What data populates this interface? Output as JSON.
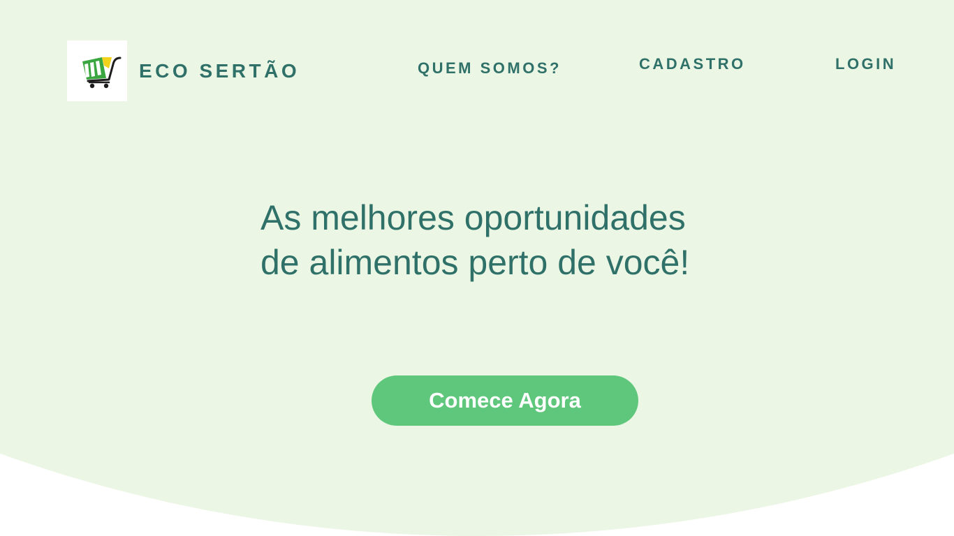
{
  "brand": {
    "name": "ECO SERTÃO",
    "logo_icon": "shopping-cart-icon"
  },
  "nav": {
    "items": [
      {
        "label": "QUEM SOMOS?"
      },
      {
        "label": "CADASTRO"
      },
      {
        "label": "LOGIN"
      }
    ]
  },
  "hero": {
    "headline_line1": "As melhores oportunidades",
    "headline_line2": "de alimentos perto de você!",
    "cta_label": "Comece Agora"
  },
  "colors": {
    "background": "#ebf6e4",
    "text": "#2f7169",
    "accent": "#5fc77c",
    "white": "#ffffff"
  }
}
